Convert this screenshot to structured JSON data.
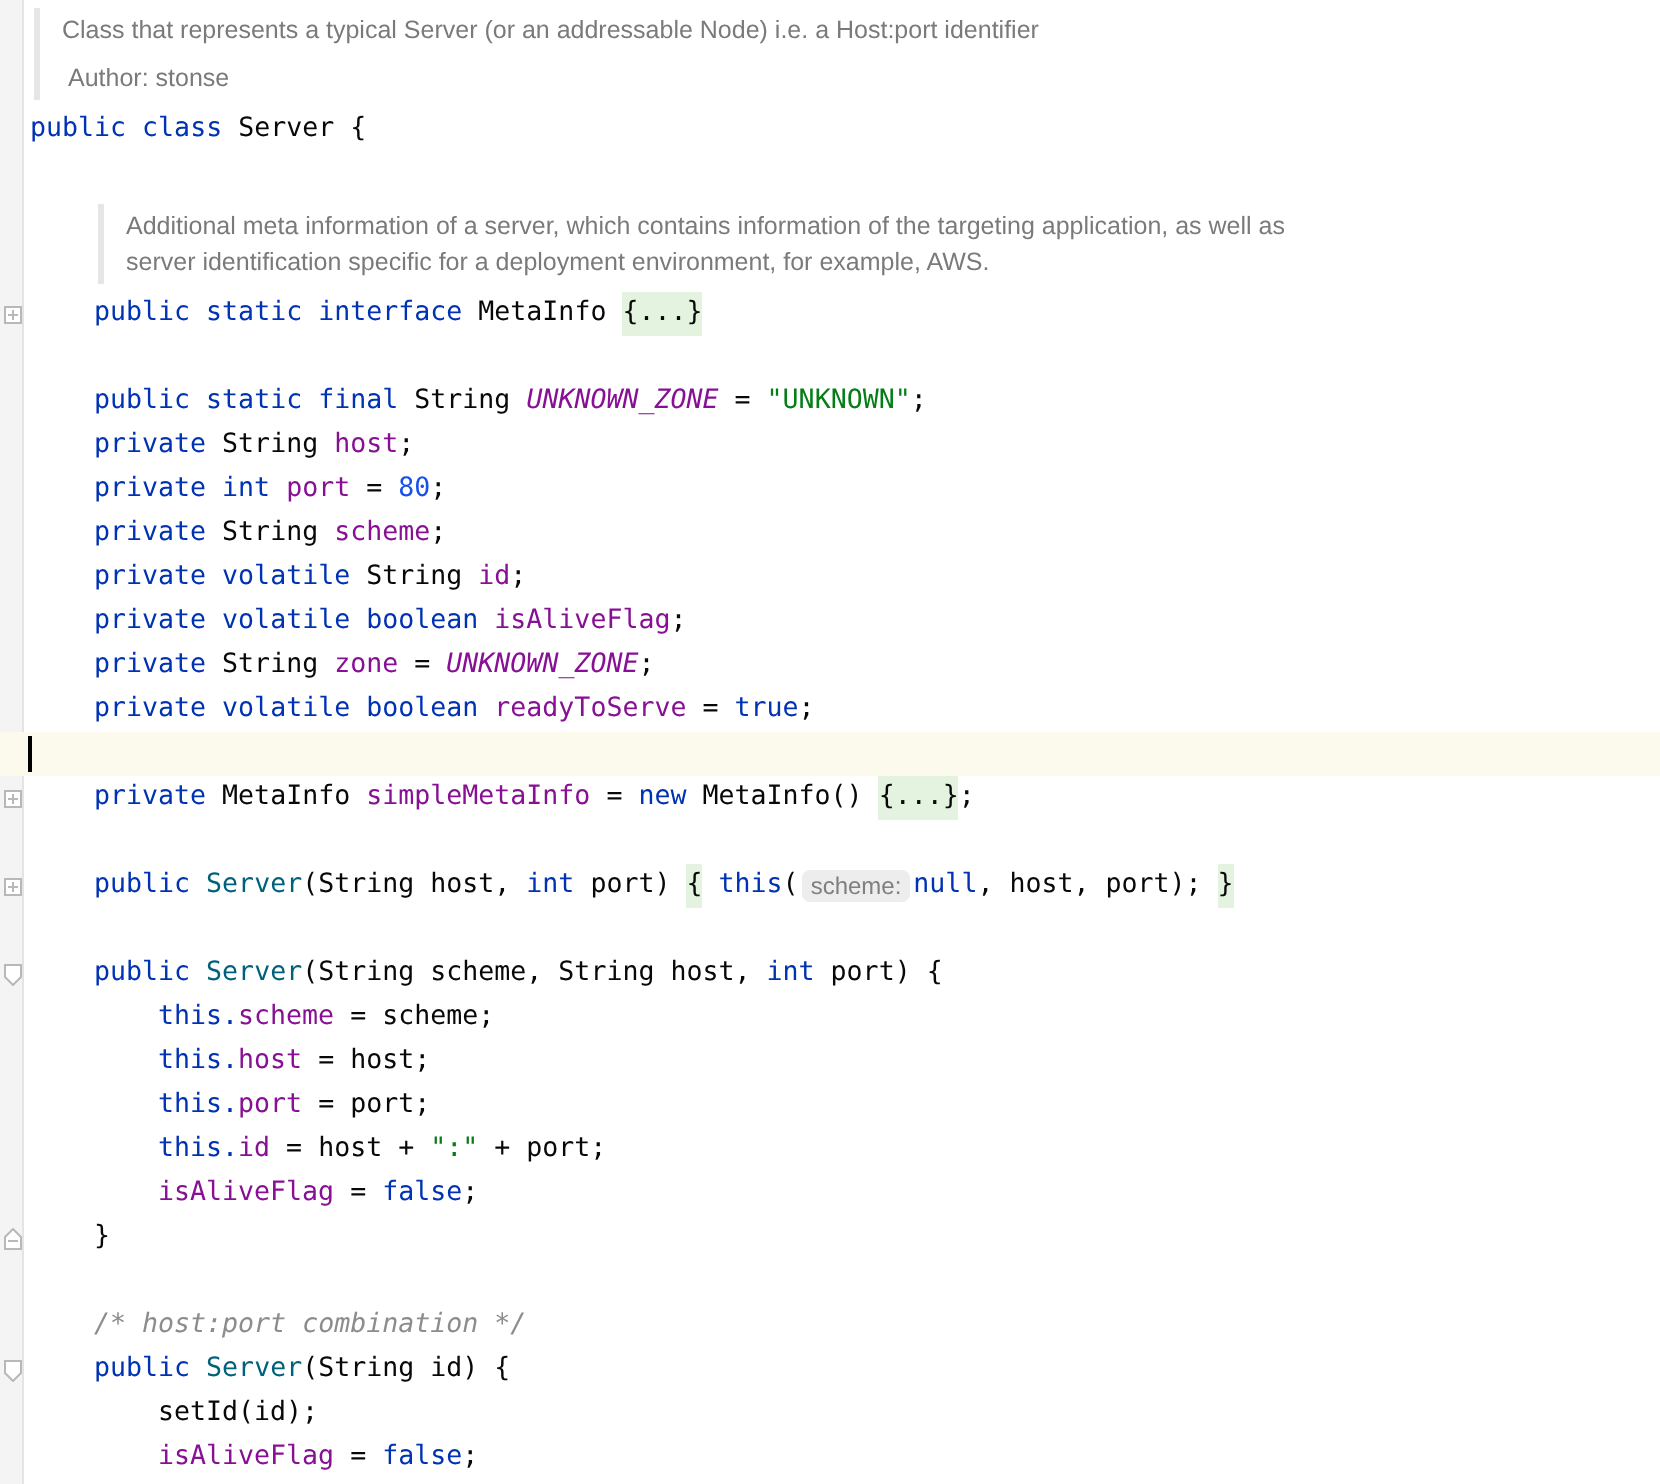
{
  "code": [
    {
      "kind": "doc",
      "paragraphs": [
        "Class that represents a typical Server (or an addressable Node) i.e. a Host:port identifier",
        "Author: stonse"
      ]
    },
    {
      "kind": "code",
      "tokens": [
        {
          "kind": "kw",
          "text": "public "
        },
        {
          "kind": "kw",
          "text": "class "
        },
        {
          "kind": "plain",
          "text": "Server {"
        }
      ],
      "children": [
        {
          "kind": "blank"
        },
        {
          "kind": "doc",
          "paragraphs": [
            "Additional meta information of a server, which contains information of the targeting application, as well as server identification specific for a deployment environment, for example, AWS."
          ]
        },
        {
          "kind": "code",
          "collapsed": true,
          "tokens": [
            {
              "kind": "kw",
              "text": "public "
            },
            {
              "kind": "kw",
              "text": "static "
            },
            {
              "kind": "kw",
              "text": "interface "
            },
            {
              "kind": "plain",
              "text": "MetaInfo "
            },
            {
              "kind": "fold",
              "text": "{...}"
            }
          ]
        },
        {
          "kind": "blank"
        },
        {
          "kind": "code",
          "tokens": [
            {
              "kind": "kw",
              "text": "public "
            },
            {
              "kind": "kw",
              "text": "static "
            },
            {
              "kind": "kw",
              "text": "final "
            },
            {
              "kind": "plain",
              "text": "String "
            },
            {
              "kind": "const",
              "text": "UNKNOWN_ZONE"
            },
            {
              "kind": "plain",
              "text": " = "
            },
            {
              "kind": "str",
              "text": "\"UNKNOWN\""
            },
            {
              "kind": "plain",
              "text": ";"
            }
          ]
        },
        {
          "kind": "code",
          "tokens": [
            {
              "kind": "kw",
              "text": "private "
            },
            {
              "kind": "plain",
              "text": "String "
            },
            {
              "kind": "field",
              "text": "host"
            },
            {
              "kind": "plain",
              "text": ";"
            }
          ]
        },
        {
          "kind": "code",
          "tokens": [
            {
              "kind": "kw",
              "text": "private "
            },
            {
              "kind": "kw",
              "text": "int "
            },
            {
              "kind": "field",
              "text": "port"
            },
            {
              "kind": "plain",
              "text": " = "
            },
            {
              "kind": "num",
              "text": "80"
            },
            {
              "kind": "plain",
              "text": ";"
            }
          ]
        },
        {
          "kind": "code",
          "tokens": [
            {
              "kind": "kw",
              "text": "private "
            },
            {
              "kind": "plain",
              "text": "String "
            },
            {
              "kind": "field",
              "text": "scheme"
            },
            {
              "kind": "plain",
              "text": ";"
            }
          ]
        },
        {
          "kind": "code",
          "tokens": [
            {
              "kind": "kw",
              "text": "private "
            },
            {
              "kind": "kw",
              "text": "volatile "
            },
            {
              "kind": "plain",
              "text": "String "
            },
            {
              "kind": "field",
              "text": "id"
            },
            {
              "kind": "plain",
              "text": ";"
            }
          ]
        },
        {
          "kind": "code",
          "tokens": [
            {
              "kind": "kw",
              "text": "private "
            },
            {
              "kind": "kw",
              "text": "volatile "
            },
            {
              "kind": "kw",
              "text": "boolean "
            },
            {
              "kind": "field",
              "text": "isAliveFlag"
            },
            {
              "kind": "plain",
              "text": ";"
            }
          ]
        },
        {
          "kind": "code",
          "tokens": [
            {
              "kind": "kw",
              "text": "private "
            },
            {
              "kind": "plain",
              "text": "String "
            },
            {
              "kind": "field",
              "text": "zone"
            },
            {
              "kind": "plain",
              "text": " = "
            },
            {
              "kind": "const",
              "text": "UNKNOWN_ZONE"
            },
            {
              "kind": "plain",
              "text": ";"
            }
          ]
        },
        {
          "kind": "code",
          "tokens": [
            {
              "kind": "kw",
              "text": "private "
            },
            {
              "kind": "kw",
              "text": "volatile "
            },
            {
              "kind": "kw",
              "text": "boolean "
            },
            {
              "kind": "field",
              "text": "readyToServe"
            },
            {
              "kind": "plain",
              "text": " = "
            },
            {
              "kind": "kw",
              "text": "true"
            },
            {
              "kind": "plain",
              "text": ";"
            }
          ]
        },
        {
          "kind": "blank",
          "caret": true
        },
        {
          "kind": "code",
          "collapsed": true,
          "tokens": [
            {
              "kind": "kw",
              "text": "private "
            },
            {
              "kind": "plain",
              "text": "MetaInfo "
            },
            {
              "kind": "field",
              "text": "simpleMetaInfo"
            },
            {
              "kind": "plain",
              "text": " = "
            },
            {
              "kind": "kw",
              "text": "new "
            },
            {
              "kind": "plain",
              "text": "MetaInfo() "
            },
            {
              "kind": "fold",
              "text": "{...}"
            },
            {
              "kind": "plain",
              "text": ";"
            }
          ]
        },
        {
          "kind": "blank"
        },
        {
          "kind": "code",
          "collapsed": true,
          "tokens": [
            {
              "kind": "kw",
              "text": "public "
            },
            {
              "kind": "method",
              "text": "Server"
            },
            {
              "kind": "plain",
              "text": "(String host, "
            },
            {
              "kind": "kw",
              "text": "int "
            },
            {
              "kind": "plain",
              "text": "port) "
            },
            {
              "kind": "fold",
              "text": "{"
            },
            {
              "kind": "kw",
              "text": " this"
            },
            {
              "kind": "plain",
              "text": "("
            },
            {
              "kind": "hint",
              "text": "scheme:"
            },
            {
              "kind": "kw",
              "text": "null"
            },
            {
              "kind": "plain",
              "text": ", host, port); "
            },
            {
              "kind": "fold",
              "text": "}"
            }
          ]
        },
        {
          "kind": "blank"
        },
        {
          "kind": "code",
          "fold_start": true,
          "tokens": [
            {
              "kind": "kw",
              "text": "public "
            },
            {
              "kind": "method",
              "text": "Server"
            },
            {
              "kind": "plain",
              "text": "(String scheme, String host, "
            },
            {
              "kind": "kw",
              "text": "int "
            },
            {
              "kind": "plain",
              "text": "port) {"
            }
          ],
          "children": [
            {
              "kind": "code",
              "tokens": [
                {
                  "kind": "kw",
                  "text": "this."
                },
                {
                  "kind": "field",
                  "text": "scheme"
                },
                {
                  "kind": "plain",
                  "text": " = scheme;"
                }
              ]
            },
            {
              "kind": "code",
              "tokens": [
                {
                  "kind": "kw",
                  "text": "this."
                },
                {
                  "kind": "field",
                  "text": "host"
                },
                {
                  "kind": "plain",
                  "text": " = host;"
                }
              ]
            },
            {
              "kind": "code",
              "tokens": [
                {
                  "kind": "kw",
                  "text": "this."
                },
                {
                  "kind": "field",
                  "text": "port"
                },
                {
                  "kind": "plain",
                  "text": " = port;"
                }
              ]
            },
            {
              "kind": "code",
              "tokens": [
                {
                  "kind": "kw",
                  "text": "this."
                },
                {
                  "kind": "field",
                  "text": "id"
                },
                {
                  "kind": "plain",
                  "text": " = host + "
                },
                {
                  "kind": "str",
                  "text": "\":\""
                },
                {
                  "kind": "plain",
                  "text": " + port;"
                }
              ]
            },
            {
              "kind": "code",
              "tokens": [
                {
                  "kind": "field",
                  "text": "isAliveFlag"
                },
                {
                  "kind": "plain",
                  "text": " = "
                },
                {
                  "kind": "kw",
                  "text": "false"
                },
                {
                  "kind": "plain",
                  "text": ";"
                }
              ]
            }
          ]
        },
        {
          "kind": "code",
          "fold_end": true,
          "tokens": [
            {
              "kind": "plain",
              "text": "}"
            }
          ]
        },
        {
          "kind": "blank"
        },
        {
          "kind": "code",
          "tokens": [
            {
              "kind": "comment",
              "text": "/* host:port combination */"
            }
          ]
        },
        {
          "kind": "code",
          "fold_start": true,
          "tokens": [
            {
              "kind": "kw",
              "text": "public "
            },
            {
              "kind": "method",
              "text": "Server"
            },
            {
              "kind": "plain",
              "text": "(String id) {"
            }
          ],
          "children": [
            {
              "kind": "code",
              "tokens": [
                {
                  "kind": "plain",
                  "text": "setId(id);"
                }
              ]
            },
            {
              "kind": "code",
              "tokens": [
                {
                  "kind": "field",
                  "text": "isAliveFlag"
                },
                {
                  "kind": "plain",
                  "text": " = "
                },
                {
                  "kind": "kw",
                  "text": "false"
                },
                {
                  "kind": "plain",
                  "text": ";"
                }
              ]
            }
          ]
        }
      ]
    }
  ]
}
